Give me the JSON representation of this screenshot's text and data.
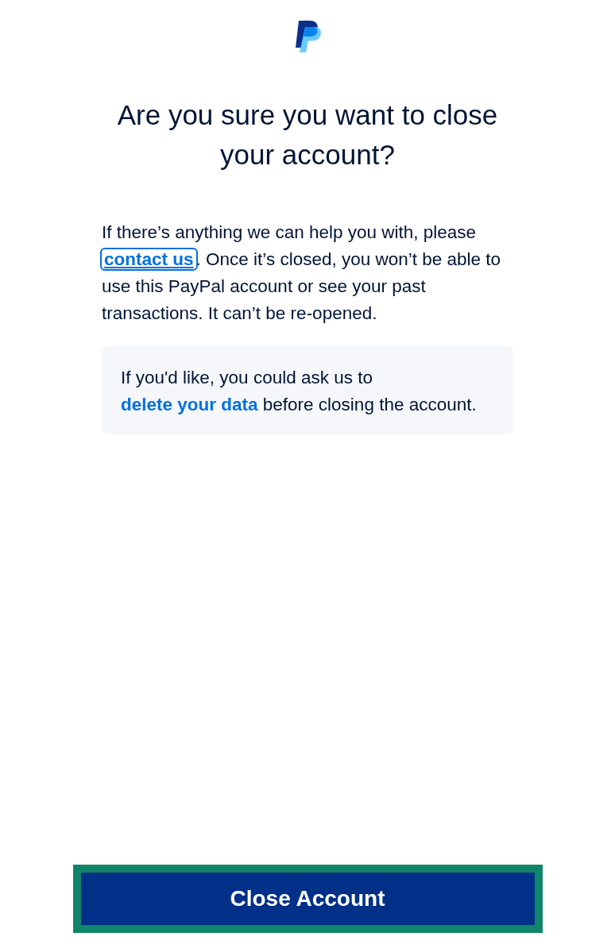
{
  "heading": "Are you sure you want to close your account?",
  "message": [
    {
      "kind": "text",
      "text": "If there’s anything we can help you with, please "
    },
    {
      "kind": "link",
      "text": "contact us",
      "focused": true
    },
    {
      "kind": "text",
      "text": ". Once it’s closed, you won’t be able to use this PayPal account or see your past transactions. It can’t be re-opened."
    }
  ],
  "note": [
    {
      "kind": "text",
      "text": "If you'd like, you could ask us to "
    },
    {
      "kind": "link",
      "text": "delete your data",
      "focused": false
    },
    {
      "kind": "text",
      "text": " before closing the account."
    }
  ],
  "button": {
    "label": "Close Account",
    "highlighted": true
  }
}
